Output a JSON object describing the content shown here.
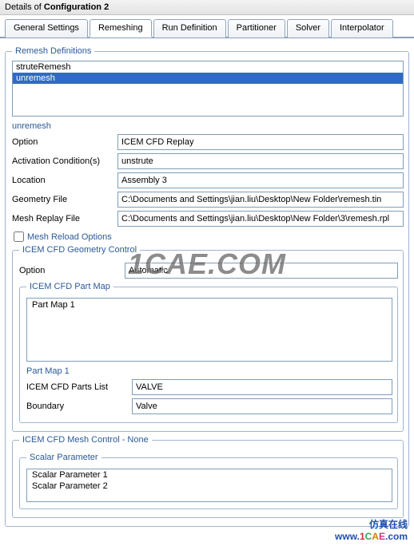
{
  "title": {
    "prefix": "Details of ",
    "name": "Configuration 2"
  },
  "tabs": [
    {
      "label": "General Settings"
    },
    {
      "label": "Remeshing"
    },
    {
      "label": "Run Definition"
    },
    {
      "label": "Partitioner"
    },
    {
      "label": "Solver"
    },
    {
      "label": "Interpolator"
    }
  ],
  "remesh_defs": {
    "legend": "Remesh Definitions",
    "items": [
      "struteRemesh",
      "unremesh"
    ],
    "selected": "unremesh"
  },
  "unremesh": {
    "heading": "unremesh",
    "rows": {
      "option": {
        "label": "Option",
        "value": "ICEM CFD Replay"
      },
      "activation": {
        "label": "Activation Condition(s)",
        "value": "unstrute"
      },
      "location": {
        "label": "Location",
        "value": "Assembly 3"
      },
      "geometry": {
        "label": "Geometry File",
        "value": "C:\\Documents and Settings\\jian.liu\\Desktop\\New Folder\\remesh.tin"
      },
      "replay": {
        "label": "Mesh Replay File",
        "value": "C:\\Documents and Settings\\jian.liu\\Desktop\\New Folder\\3\\remesh.rpl"
      }
    },
    "mesh_reload": {
      "label": "Mesh Reload Options",
      "checked": false
    }
  },
  "geom_control": {
    "legend": "ICEM CFD Geometry Control",
    "option": {
      "label": "Option",
      "value": "Automatic"
    },
    "part_map_legend": "ICEM CFD Part Map",
    "part_map_item": "Part Map 1",
    "part_map_section": {
      "heading": "Part Map 1",
      "parts_list": {
        "label": "ICEM CFD Parts List",
        "value": "VALVE"
      },
      "boundary": {
        "label": "Boundary",
        "value": "Valve"
      }
    }
  },
  "mesh_control": {
    "legend": "ICEM CFD Mesh Control - None",
    "scalar_legend": "Scalar Parameter",
    "scalar_items": [
      "Scalar Parameter 1",
      "Scalar Parameter 2"
    ]
  },
  "watermark": "1CAE.COM",
  "footer": {
    "cn": "仿真在线",
    "url": "www.1CAE.com"
  }
}
